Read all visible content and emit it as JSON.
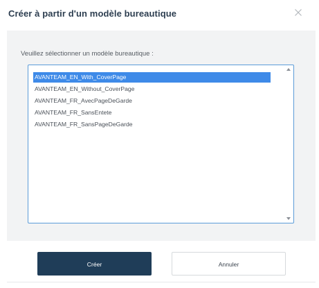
{
  "dialog": {
    "title": "Créer à partir d'un modèle bureautique",
    "close_icon": "close-icon"
  },
  "body": {
    "select_label": "Veuillez sélectionner un modèle bureautique :",
    "options": [
      {
        "label": "AVANTEAM_EN_With_CoverPage",
        "selected": true
      },
      {
        "label": "AVANTEAM_EN_Without_CoverPage",
        "selected": false
      },
      {
        "label": "AVANTEAM_FR_AvecPageDeGarde",
        "selected": false
      },
      {
        "label": "AVANTEAM_FR_SansEntete",
        "selected": false
      },
      {
        "label": "AVANTEAM_FR_SansPageDeGarde",
        "selected": false
      }
    ]
  },
  "footer": {
    "create_label": "Créer",
    "cancel_label": "Annuler"
  },
  "colors": {
    "primary": "#1f3d58",
    "selection": "#3e8ae8",
    "listbox_border": "#5b9bd8",
    "body_background": "#f2f3f4"
  }
}
